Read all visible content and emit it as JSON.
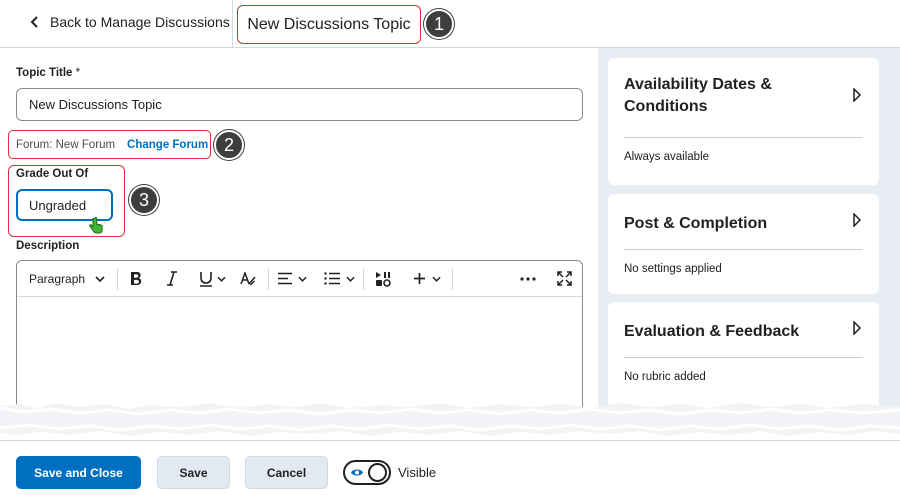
{
  "header": {
    "back_label": "Back to Manage Discussions",
    "page_title": "New Discussions Topic"
  },
  "callouts": [
    "1",
    "2",
    "3"
  ],
  "form": {
    "topic_title_label": "Topic Title",
    "required_mark": "*",
    "topic_title_value": "New Discussions Topic",
    "forum_label": "Forum: New Forum",
    "change_forum_label": "Change Forum",
    "grade_label": "Grade Out Of",
    "grade_value": "Ungraded",
    "description_label": "Description"
  },
  "editor": {
    "paragraph_style": "Paragraph",
    "icons": [
      "bold-icon",
      "italic-icon",
      "underline-icon",
      "text-format-icon",
      "align-icon",
      "list-icon",
      "media-icon",
      "insert-icon",
      "more-icon",
      "fullscreen-icon"
    ]
  },
  "sidebar": {
    "cards": [
      {
        "title_line1": "Availability Dates &",
        "title_line2": "Conditions",
        "subtitle": "Always available"
      },
      {
        "title": "Post & Completion",
        "subtitle": "No settings applied"
      },
      {
        "title": "Evaluation & Feedback",
        "subtitle": "No rubric added"
      }
    ]
  },
  "footer": {
    "save_close_label": "Save and Close",
    "save_label": "Save",
    "cancel_label": "Cancel",
    "visibility_label": "Visible",
    "visibility_on": true
  },
  "colors": {
    "accent": "#006fbf",
    "highlight": "#d6303a",
    "sidebar_bg": "#e8edf3"
  }
}
